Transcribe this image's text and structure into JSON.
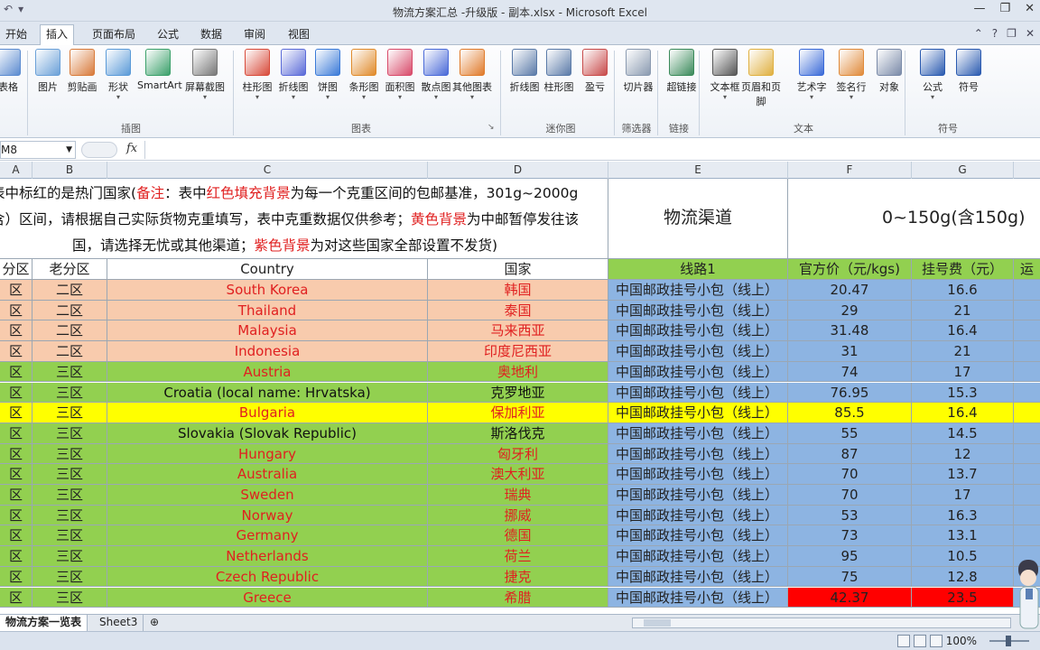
{
  "window": {
    "title": "物流方案汇总 -升级版 - 副本.xlsx - Microsoft Excel",
    "quick_access": [
      "↶",
      "▾"
    ],
    "controls": [
      "—",
      "❐",
      "✕"
    ]
  },
  "ribbon_tabs": [
    "开始",
    "插入",
    "页面布局",
    "公式",
    "数据",
    "审阅",
    "视图"
  ],
  "active_tab": "插入",
  "ribbon": {
    "buttons": [
      {
        "label": "表格",
        "icon": "table-icon",
        "color": "#5b8bd0"
      },
      {
        "label": "图片",
        "icon": "picture-icon",
        "color": "#6aa0d8"
      },
      {
        "label": "剪贴画",
        "icon": "clipart-icon",
        "color": "#d87a3a"
      },
      {
        "label": "形状",
        "icon": "shapes-icon",
        "color": "#5a9ad8"
      },
      {
        "label": "SmartArt",
        "icon": "smartart-icon",
        "color": "#3aa06a"
      },
      {
        "label": "屏幕截图",
        "icon": "screenshot-icon",
        "color": "#777"
      },
      {
        "label": "柱形图",
        "icon": "column-chart-icon",
        "color": "#d84a3a"
      },
      {
        "label": "折线图",
        "icon": "line-chart-icon",
        "color": "#5a6ad8"
      },
      {
        "label": "饼图",
        "icon": "pie-chart-icon",
        "color": "#3a7ad8"
      },
      {
        "label": "条形图",
        "icon": "bar-chart-icon",
        "color": "#e08a2a"
      },
      {
        "label": "面积图",
        "icon": "area-chart-icon",
        "color": "#d84a6a"
      },
      {
        "label": "散点图",
        "icon": "scatter-chart-icon",
        "color": "#4a6ad8"
      },
      {
        "label": "其他图表",
        "icon": "other-chart-icon",
        "color": "#e07a2a"
      },
      {
        "label": "折线图",
        "icon": "sparkline-line-icon",
        "color": "#5a7aa8"
      },
      {
        "label": "柱形图",
        "icon": "sparkline-column-icon",
        "color": "#5a7aa8"
      },
      {
        "label": "盈亏",
        "icon": "winloss-icon",
        "color": "#c84a4a"
      },
      {
        "label": "切片器",
        "icon": "slicer-icon",
        "color": "#8a9ab0"
      },
      {
        "label": "超链接",
        "icon": "hyperlink-icon",
        "color": "#3a8a5a"
      },
      {
        "label": "文本框",
        "icon": "textbox-icon",
        "color": "#555"
      },
      {
        "label": "页眉和页脚",
        "icon": "header-footer-icon",
        "color": "#e0b040"
      },
      {
        "label": "艺术字",
        "icon": "wordart-icon",
        "color": "#3a6ad8"
      },
      {
        "label": "签名行",
        "icon": "signature-icon",
        "color": "#e08a3a"
      },
      {
        "label": "对象",
        "icon": "object-icon",
        "color": "#7a8aa8"
      },
      {
        "label": "公式",
        "icon": "equation-icon",
        "color": "#2a5ab0"
      },
      {
        "label": "符号",
        "icon": "symbol-icon",
        "color": "#2a5ab0"
      }
    ],
    "groups": [
      "插图",
      "图表",
      "迷你图",
      "筛选器",
      "链接",
      "文本",
      "符号"
    ]
  },
  "formula_bar": {
    "name_box": "M8",
    "fx": "fx",
    "content": ""
  },
  "columns": [
    "A",
    "B",
    "C",
    "D",
    "E",
    "F",
    "G"
  ],
  "header": {
    "line1_a": "表中标红的是热门国家(",
    "line1_b": "备注",
    "line1_c": "：表中",
    "line1_d": "红色填充背景",
    "line1_e": "为每一个克重区间的包邮基准，301g~2000g",
    "line2_a": "含）区间，请根据自己实际货物克重填写，表中克重数据仅供参考；",
    "line2_b": "黄色背景",
    "line2_c": "为中邮暂停发往该",
    "line3_a": "国，请选择无忧或其他渠道；",
    "line3_b": "紫色背景",
    "line3_c": "为对这些国家全部设置不发货)",
    "channel_title": "物流渠道",
    "weight_range": "0~150g(含150g)"
  },
  "table_header": {
    "a": "分区",
    "b": "老分区",
    "c": "Country",
    "d": "国家",
    "e": "线路1",
    "f": "官方价（元/kgs)",
    "g": "挂号费（元）",
    "h": "运"
  },
  "rows": [
    {
      "a": "区",
      "b": "二区",
      "c": "South Korea",
      "d": "韩国",
      "e": "中国邮政挂号小包（线上）",
      "f": "20.47",
      "g": "16.6",
      "bg": "#f8cbad",
      "fg": "red"
    },
    {
      "a": "区",
      "b": "二区",
      "c": "Thailand",
      "d": "泰国",
      "e": "中国邮政挂号小包（线上）",
      "f": "29",
      "g": "21",
      "bg": "#f8cbad",
      "fg": "red"
    },
    {
      "a": "区",
      "b": "二区",
      "c": "Malaysia",
      "d": "马来西亚",
      "e": "中国邮政挂号小包（线上）",
      "f": "31.48",
      "g": "16.4",
      "bg": "#f8cbad",
      "fg": "red"
    },
    {
      "a": "区",
      "b": "二区",
      "c": "Indonesia",
      "d": "印度尼西亚",
      "e": "中国邮政挂号小包（线上）",
      "f": "31",
      "g": "21",
      "bg": "#f8cbad",
      "fg": "red"
    },
    {
      "a": "区",
      "b": "三区",
      "c": "Austria",
      "d": "奥地利",
      "e": "中国邮政挂号小包（线上）",
      "f": "74",
      "g": "17",
      "bg": "#92d050",
      "fg": "red"
    },
    {
      "a": "区",
      "b": "三区",
      "c": "Croatia (local name: Hrvatska)",
      "d": "克罗地亚",
      "e": "中国邮政挂号小包（线上）",
      "f": "76.95",
      "g": "15.3",
      "bg": "#92d050",
      "fg": "blk"
    },
    {
      "a": "区",
      "b": "三区",
      "c": "Bulgaria",
      "d": "保加利亚",
      "e": "中国邮政挂号小包（线上）",
      "f": "85.5",
      "g": "16.4",
      "bg": "#ffff00",
      "fg": "red",
      "yellow": true
    },
    {
      "a": "区",
      "b": "三区",
      "c": "Slovakia (Slovak Republic)",
      "d": "斯洛伐克",
      "e": "中国邮政挂号小包（线上）",
      "f": "55",
      "g": "14.5",
      "bg": "#92d050",
      "fg": "blk"
    },
    {
      "a": "区",
      "b": "三区",
      "c": "Hungary",
      "d": "匈牙利",
      "e": "中国邮政挂号小包（线上）",
      "f": "87",
      "g": "12",
      "bg": "#92d050",
      "fg": "red"
    },
    {
      "a": "区",
      "b": "三区",
      "c": "Australia",
      "d": "澳大利亚",
      "e": "中国邮政挂号小包（线上）",
      "f": "70",
      "g": "13.7",
      "bg": "#92d050",
      "fg": "red"
    },
    {
      "a": "区",
      "b": "三区",
      "c": "Sweden",
      "d": "瑞典",
      "e": "中国邮政挂号小包（线上）",
      "f": "70",
      "g": "17",
      "bg": "#92d050",
      "fg": "red"
    },
    {
      "a": "区",
      "b": "三区",
      "c": "Norway",
      "d": "挪威",
      "e": "中国邮政挂号小包（线上）",
      "f": "53",
      "g": "16.3",
      "bg": "#92d050",
      "fg": "red"
    },
    {
      "a": "区",
      "b": "三区",
      "c": "Germany",
      "d": "德国",
      "e": "中国邮政挂号小包（线上）",
      "f": "73",
      "g": "13.1",
      "bg": "#92d050",
      "fg": "red"
    },
    {
      "a": "区",
      "b": "三区",
      "c": "Netherlands",
      "d": "荷兰",
      "e": "中国邮政挂号小包（线上）",
      "f": "95",
      "g": "10.5",
      "bg": "#92d050",
      "fg": "red"
    },
    {
      "a": "区",
      "b": "三区",
      "c": "Czech Republic",
      "d": "捷克",
      "e": "中国邮政挂号小包（线上）",
      "f": "75",
      "g": "12.8",
      "bg": "#92d050",
      "fg": "red"
    },
    {
      "a": "区",
      "b": "三区",
      "c": "Greece",
      "d": "希腊",
      "e": "中国邮政挂号小包（线上）",
      "f": "42.37",
      "g": "23.5",
      "bg": "#92d050",
      "fg": "red",
      "base": true
    }
  ],
  "colors": {
    "route_cell": "#8db4e2",
    "price_cell": "#8db4e2",
    "base_price": "#ff0000",
    "header_green": "#92d050",
    "red_text": "#e02020"
  },
  "sheet_tabs": [
    "物流方案一览表",
    "Sheet3"
  ],
  "active_sheet": "物流方案一览表",
  "status": {
    "zoom": "100%"
  }
}
